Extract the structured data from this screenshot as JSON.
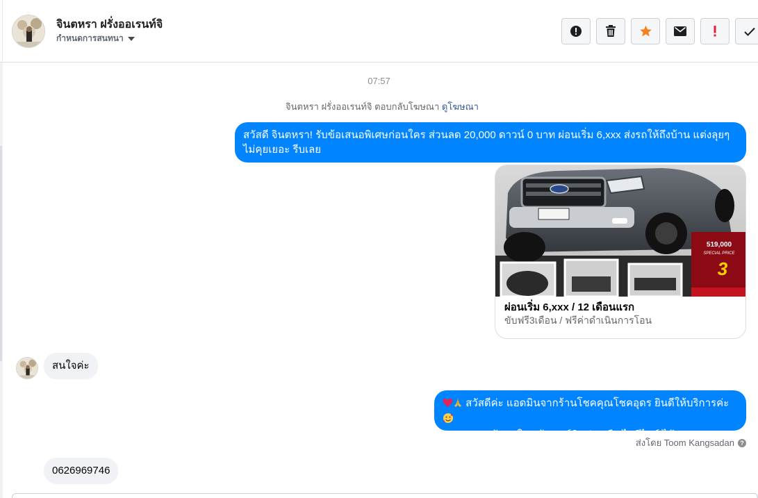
{
  "header": {
    "contact_name": "จินตหรา ฝรั่งออเรนท์จิ",
    "assign_label": "กำหนดการสนทนา",
    "toolbar": [
      {
        "name": "spam-button",
        "icon": "alert-circle-icon"
      },
      {
        "name": "delete-button",
        "icon": "trash-icon"
      },
      {
        "name": "star-button",
        "icon": "star-icon",
        "color": "#f5821f"
      },
      {
        "name": "mark-unread-button",
        "icon": "envelope-icon"
      },
      {
        "name": "important-button",
        "icon": "exclamation-icon",
        "color": "#e41e3f"
      },
      {
        "name": "done-button",
        "icon": "checkmark-icon"
      }
    ]
  },
  "thread": {
    "timestamp": "07:57",
    "ad_reply_text": "จินตหรา ฝรั่งออเรนท์จิ ตอบกลับโฆษณา",
    "ad_reply_link": "ดูโฆษณา",
    "messages": [
      {
        "direction": "outgoing",
        "text": "สวัสดี จินตหรา! รับข้อเสนอพิเศษก่อนใคร ส่วนลด 20,000 ดาวน์ 0 บาท ผ่อนเริ่ม 6,xxx ส่งรถให้ถึงบ้าน แต่งลุยๆ ไม่คุยเยอะ รีบเลย"
      },
      {
        "direction": "outgoing",
        "type": "card",
        "title": "ผ่อนเริ่ม 6,xxx / 12 เดือนแรก",
        "subtitle": "ขับฟรี3เดือน / ฟรีค่าดำเนินการโอน",
        "image_price": "519,000",
        "image_tag": "SPECIAL PRICE",
        "image_number": "3"
      },
      {
        "direction": "incoming",
        "text": "สนใจค่ะ"
      },
      {
        "direction": "outgoing",
        "text_line1": "สวัสดีค่ะ แอดมินจากร้านโชคคุณโชคอุดร ยินดีให้บริการค่ะ",
        "text_line2": "หากคุณลูกค้าสนใจ แจ้งเบอร์ติดต่อ หรือ ไอดีไลน์ ได้เลยนะคะ"
      },
      {
        "direction": "incoming",
        "text": "0626969746"
      }
    ],
    "sent_by": "ส่งโดย Toom Kangsadan"
  },
  "colors": {
    "outgoing_bubble": "#0084ff",
    "incoming_bubble": "#f0f2f5",
    "link": "#385898"
  }
}
